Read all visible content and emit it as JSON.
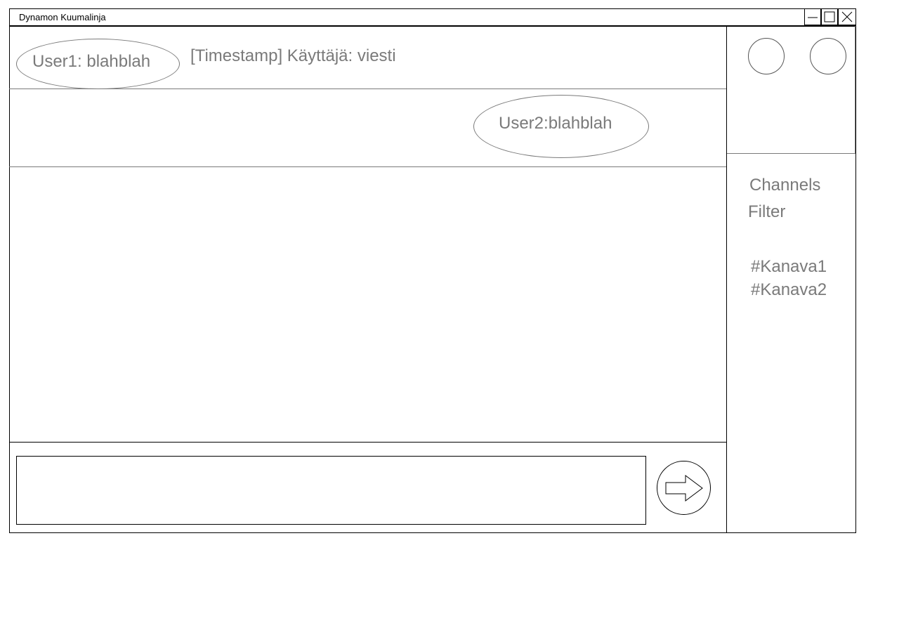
{
  "window": {
    "title": "Dynamon Kuumalinja",
    "controls": {
      "minimize_icon": "minimize-icon",
      "maximize_icon": "maximize-icon",
      "close_icon": "close-icon"
    }
  },
  "chat": {
    "messages": [
      {
        "bubble": "User1: blahblah",
        "note": "[Timestamp] Käyttäjä: viesti"
      },
      {
        "bubble": "User2:blahblah"
      }
    ]
  },
  "sidebar": {
    "channels_label": "Channels",
    "filter_label": "Filter",
    "channels": [
      "#Kanava1",
      "#Kanava2"
    ]
  },
  "composer": {
    "input_value": "",
    "send_icon": "arrow-right-icon"
  },
  "colors": {
    "text_gray": "#7a7a7a",
    "border": "#000000",
    "background": "#ffffff"
  }
}
